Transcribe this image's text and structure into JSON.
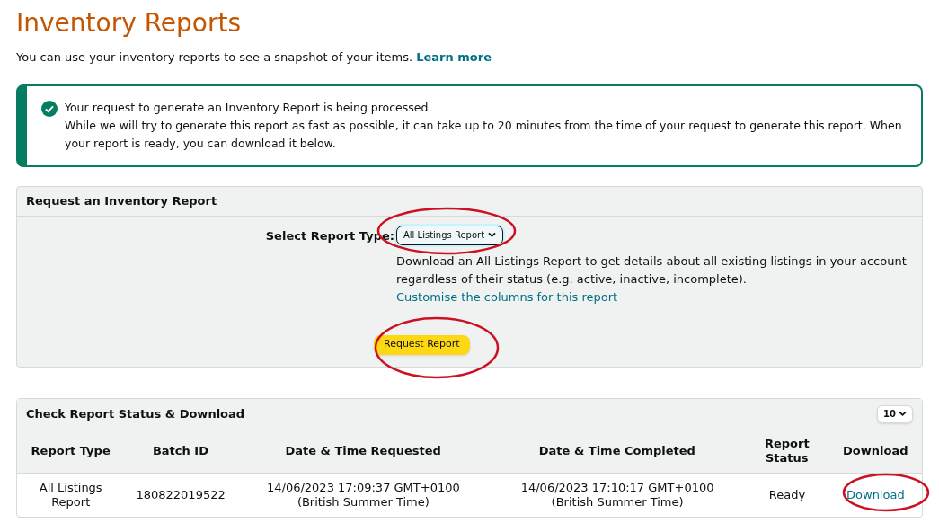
{
  "title": "Inventory Reports",
  "intro": {
    "text": "You can use your inventory reports to see a snapshot of your items.",
    "link": "Learn more"
  },
  "alert": {
    "lines": [
      "Your request to generate an Inventory Report is being processed.",
      "While we will try to generate this report as fast as possible, it can take up to 20 minutes from the time of your request to generate this report. When your report is ready, you can download it below."
    ]
  },
  "request_panel": {
    "title": "Request an Inventory Report",
    "field_label": "Select Report Type:",
    "report_type": "All Listings Report",
    "description": "Download an All Listings Report to get details about all existing listings in your account regardless of their status (e.g. active, inactive, incomplete).",
    "customise_link": "Customise the columns for this report",
    "button": "Request Report"
  },
  "status_panel": {
    "title": "Check Report Status & Download",
    "page_size": "10",
    "table": {
      "columns": [
        "Report Type",
        "Batch ID",
        "Date & Time Requested",
        "Date & Time Completed",
        "Report Status",
        "Download"
      ],
      "rows": [
        {
          "report_type": "All Listings Report",
          "batch_id": "180822019522",
          "requested": [
            "14/06/2023 17:09:37 GMT+0100",
            "(British Summer Time)"
          ],
          "completed": [
            "14/06/2023 17:10:17 GMT+0100",
            "(British Summer Time)"
          ],
          "status": "Ready",
          "download": "Download"
        }
      ]
    }
  }
}
